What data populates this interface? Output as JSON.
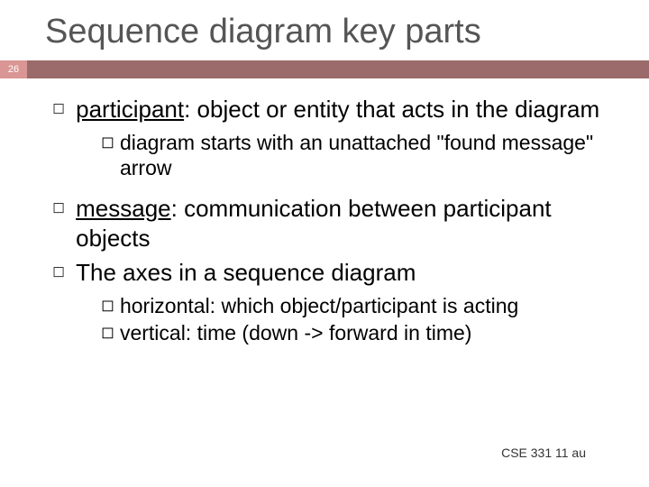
{
  "slide": {
    "title": "Sequence diagram key parts",
    "page_number": "26",
    "footer": "CSE 331 11 au"
  },
  "bullets": {
    "b1": {
      "term": "participant",
      "rest": ": object or entity that acts in the diagram",
      "sub1": "diagram starts with an unattached \"found message\" arrow"
    },
    "b2": {
      "term": "message",
      "rest": ": communication between participant objects"
    },
    "b3": {
      "text": "The axes in a sequence diagram",
      "sub1": "horizontal: which object/participant is acting",
      "sub2": "vertical:  time  (down -> forward in time)"
    }
  }
}
